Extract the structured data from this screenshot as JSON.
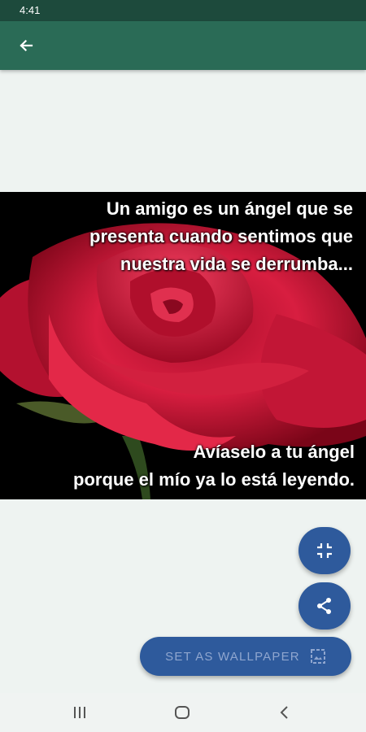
{
  "status_bar": {
    "time": "4:41"
  },
  "app_bar": {
    "back_icon": "arrow-left-icon"
  },
  "image": {
    "quote_top": [
      "Un amigo es un ángel que se",
      "presenta cuando sentimos que",
      "nuestra vida se derrumba..."
    ],
    "quote_bottom": [
      "Avíaselo a tu ángel",
      "porque el mío ya lo está leyendo."
    ]
  },
  "actions": {
    "fullscreen_icon": "fullscreen-icon",
    "share_icon": "share-icon",
    "set_wallpaper_label": "SET AS WALLPAPER",
    "wallpaper_icon": "wallpaper-icon"
  },
  "nav_bar": {
    "recent": "recent-apps-icon",
    "home": "home-icon",
    "back": "back-icon"
  },
  "colors": {
    "status_bar": "#1d4a3c",
    "app_bar": "#2a6b56",
    "fab": "#2e5a9c",
    "background": "#eef3f1"
  }
}
